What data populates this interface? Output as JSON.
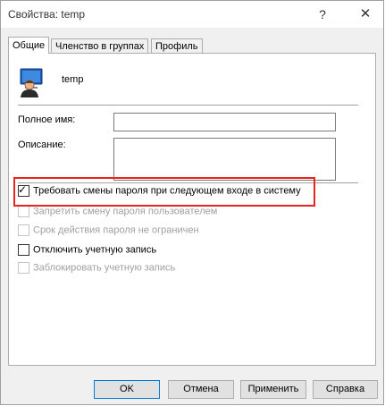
{
  "window": {
    "title": "Свойства: temp",
    "help_glyph": "?",
    "close_glyph": "✕"
  },
  "tabs": [
    {
      "label": "Общие",
      "active": true
    },
    {
      "label": "Членство в группах",
      "active": false
    },
    {
      "label": "Профиль",
      "active": false
    }
  ],
  "user": {
    "name": "temp",
    "icon": "user-account-icon"
  },
  "fields": {
    "full_name_label": "Полное имя:",
    "full_name_value": "",
    "description_label": "Описание:",
    "description_value": ""
  },
  "options": [
    {
      "label": "Требовать смены пароля при следующем входе в систему",
      "checked": true,
      "enabled": true
    },
    {
      "label": "Запретить смену пароля пользователем",
      "checked": false,
      "enabled": false
    },
    {
      "label": "Срок действия пароля не ограничен",
      "checked": false,
      "enabled": false
    },
    {
      "label": "Отключить учетную запись",
      "checked": false,
      "enabled": true
    },
    {
      "label": "Заблокировать учетную запись",
      "checked": false,
      "enabled": false
    }
  ],
  "highlight_color": "#e8241c",
  "buttons": {
    "ok": "OK",
    "cancel": "Отмена",
    "apply": "Применить",
    "help": "Справка"
  }
}
